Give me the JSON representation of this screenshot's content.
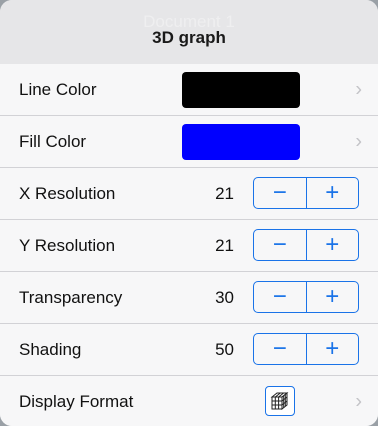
{
  "background": {
    "document_title": "Document 1"
  },
  "dialog": {
    "title": "3D graph"
  },
  "colors": {
    "accent": "#1a73e8",
    "line_color": "#000000",
    "fill_color": "#0000ff"
  },
  "rows": {
    "line_color": {
      "label": "Line Color"
    },
    "fill_color": {
      "label": "Fill Color"
    },
    "x_resolution": {
      "label": "X Resolution",
      "value": "21"
    },
    "y_resolution": {
      "label": "Y Resolution",
      "value": "21"
    },
    "transparency": {
      "label": "Transparency",
      "value": "30"
    },
    "shading": {
      "label": "Shading",
      "value": "50"
    },
    "display_format": {
      "label": "Display Format",
      "icon": "wireframe-cube-icon"
    }
  },
  "stepper": {
    "minus": "−",
    "plus": "+"
  },
  "chevron": "›"
}
